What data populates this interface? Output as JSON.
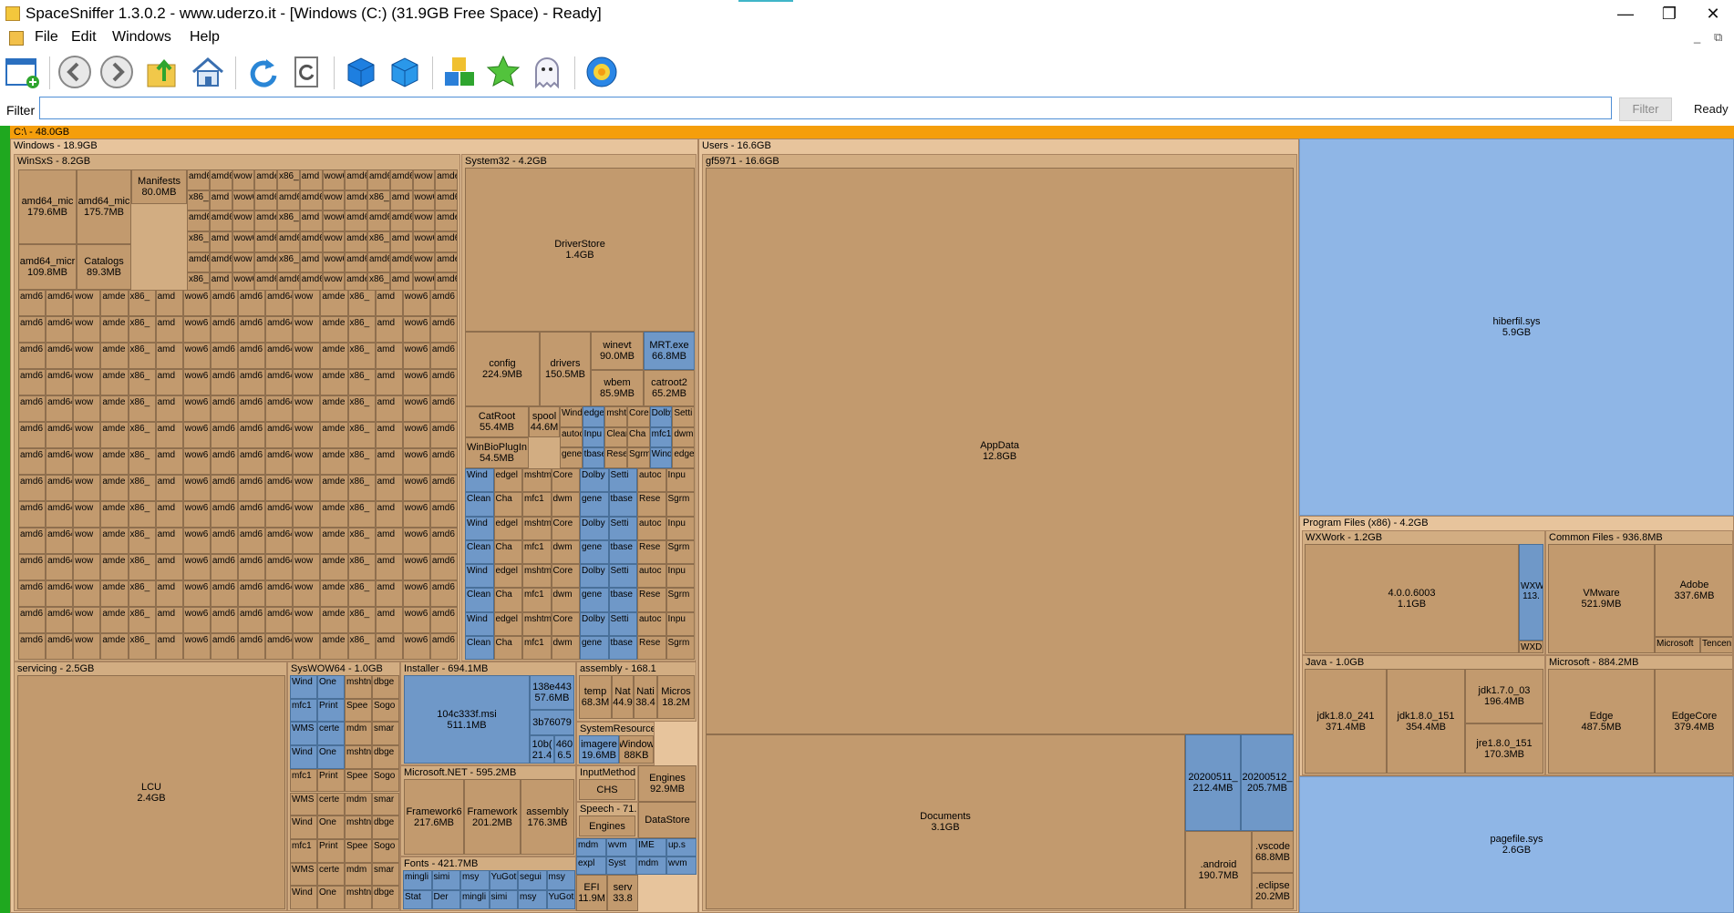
{
  "window": {
    "title": "SpaceSniffer 1.3.0.2 - www.uderzo.it - [Windows (C:) (31.9GB Free Space) - Ready]",
    "minimize": "—",
    "maximize": "❐",
    "close": "✕"
  },
  "menu": {
    "items": [
      "File",
      "Edit",
      "Windows",
      "Help"
    ],
    "mdi_min": "_",
    "mdi_restore": "⧉"
  },
  "toolbar": {
    "icons": [
      "new-window-icon",
      "back-icon",
      "forward-icon",
      "up-folder-icon",
      "home-icon",
      "refresh-icon",
      "refresh-page-icon",
      "zoom-in-cube-icon",
      "zoom-out-cube-icon",
      "tags-icon",
      "star-icon",
      "ghost-icon",
      "settings-icon"
    ]
  },
  "filter": {
    "label": "Filter",
    "value": "",
    "button": "Filter",
    "status": "Ready"
  },
  "map": {
    "root": "C:\\ - 48.0GB",
    "windows": "Windows - 18.9GB",
    "winsxs": "WinSxS - 8.2GB",
    "system32": "System32 - 4.2GB",
    "servicing": "servicing - 2.5GB",
    "syswow64": "SysWOW64 - 1.0GB",
    "installer": "Installer - 694.1MB",
    "assembly": "assembly - 168.1",
    "msnet": "Microsoft.NET - 595.2MB",
    "fonts": "Fonts - 421.7MB",
    "users": "Users - 16.6GB",
    "gf5971": "gf5971 - 16.6GB",
    "pfx86": "Program Files (x86) - 4.2GB",
    "wxwork": "WXWork - 1.2GB",
    "common_files": "Common Files - 936.8MB",
    "java": "Java - 1.0GB",
    "microsoft": "Microsoft - 884.2MB",
    "files": {
      "driverstore": [
        "DriverStore",
        "1.4GB"
      ],
      "lcu": [
        "LCU",
        "2.4GB"
      ],
      "appdata": [
        "AppData",
        "12.8GB"
      ],
      "documents": [
        "Documents",
        "3.1GB"
      ],
      "hiberfil": [
        "hiberfil.sys",
        "5.9GB"
      ],
      "pagefile": [
        "pagefile.sys",
        "2.6GB"
      ],
      "wx_ver": [
        "4.0.0.6003",
        "1.1GB"
      ],
      "vmware": [
        "VMware",
        "521.9MB"
      ],
      "adobe": [
        "Adobe",
        "337.6MB"
      ],
      "jdk241": [
        "jdk1.8.0_241",
        "371.4MB"
      ],
      "jdk151": [
        "jdk1.8.0_151",
        "354.4MB"
      ],
      "jdk170": [
        "jdk1.7.0_03",
        "196.4MB"
      ],
      "jre151": [
        "jre1.8.0_151",
        "170.3MB"
      ],
      "edge": [
        "Edge",
        "487.5MB"
      ],
      "edgecore": [
        "EdgeCore",
        "379.4MB"
      ],
      "d20200511a": [
        "20200511_",
        "212.4MB"
      ],
      "d20200512": [
        "20200512_",
        "205.7MB"
      ],
      "android": [
        ".android",
        "190.7MB"
      ],
      "vscode": [
        ".vscode",
        "68.8MB"
      ],
      "eclipse": [
        ".eclipse",
        "20.2MB"
      ],
      "config": [
        "config",
        "224.9MB"
      ],
      "drivers": [
        "drivers",
        "150.5MB"
      ],
      "winevt": [
        "winevt",
        "90.0MB"
      ],
      "wbem": [
        "wbem",
        "85.9MB"
      ],
      "mrt": [
        "MRT.exe",
        "66.8MB"
      ],
      "catroot2": [
        "catroot2",
        "65.2MB"
      ],
      "catroot": [
        "CatRoot",
        "55.4MB"
      ],
      "spool": [
        "spool",
        "44.6M"
      ],
      "winbioplugin": [
        "WinBioPlugIn",
        "54.5MB"
      ],
      "msi104": [
        "104c333f.msi",
        "511.1MB"
      ],
      "msi138": [
        "138e443",
        "57.6MB"
      ],
      "msi3b7": [
        "3b76079",
        ""
      ],
      "msi10b": [
        "10b(",
        "21.4"
      ],
      "msi460": [
        "460",
        "6.5"
      ],
      "fw1": [
        "Framework6",
        "217.6MB"
      ],
      "fw2": [
        "Framework",
        "201.2MB"
      ],
      "asm": [
        "assembly",
        "176.3MB"
      ],
      "temp": [
        "temp",
        "68.3M"
      ],
      "nat1": [
        "Nat",
        "44.9"
      ],
      "nat2": [
        "Nati",
        "38.4"
      ],
      "micros1": [
        "Micros",
        "18.2M"
      ],
      "sysres": [
        "SystemResource",
        ""
      ],
      "imagere": [
        "imagere",
        "19.6MB"
      ],
      "window88": [
        "Window",
        "88KB"
      ],
      "inputmethod": [
        "InputMethod",
        ""
      ],
      "chs": [
        "CHS",
        ""
      ],
      "engines1": [
        "Engines",
        "92.9MB"
      ],
      "speech": [
        "Speech - 71.",
        ""
      ],
      "engines2": [
        "Engines",
        ""
      ],
      "datastore": [
        "DataStore",
        ""
      ],
      "efi": [
        "EFI",
        "11.9M"
      ],
      "serv": [
        "serv",
        "33.8"
      ],
      "mics1": [
        "Manifests",
        "80.0MB"
      ],
      "winsxs1": [
        "amd64_mic",
        "179.6MB"
      ],
      "winsxs2": [
        "amd64_mic",
        "175.7MB"
      ],
      "winsxs3": [
        "amd64_micr",
        "109.8MB"
      ],
      "catalogs": [
        "Catalogs",
        "89.3MB"
      ]
    }
  }
}
